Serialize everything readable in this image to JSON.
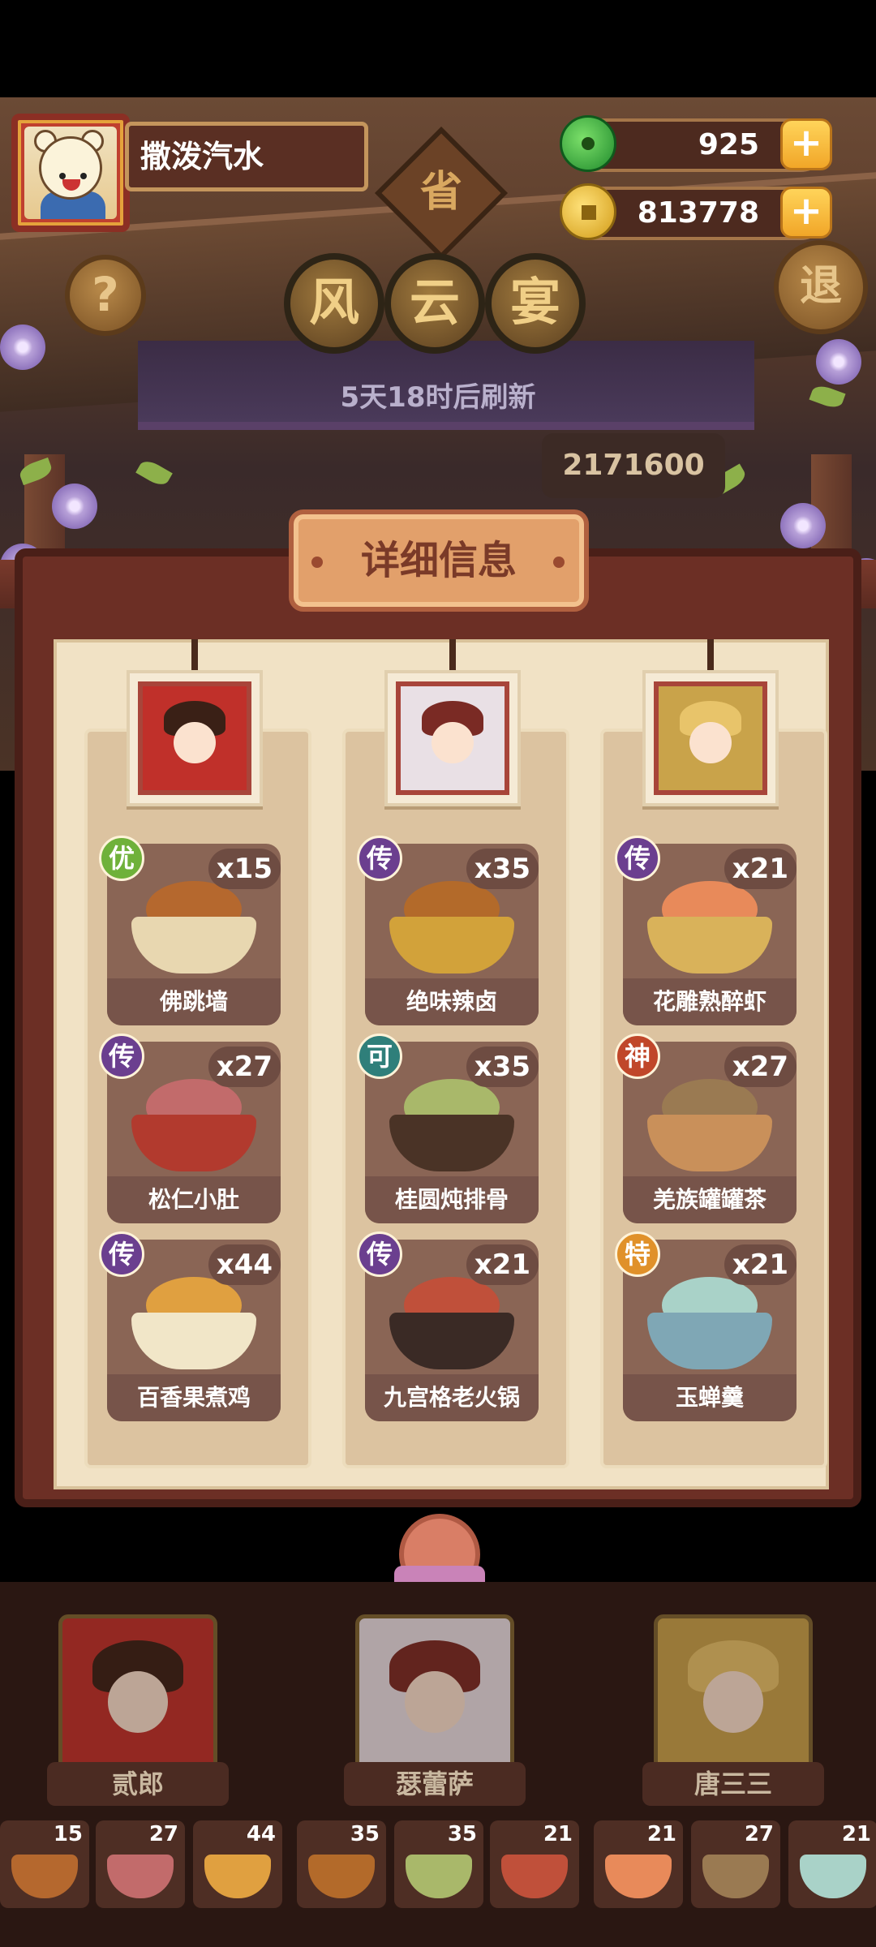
{
  "player": {
    "name": "撒泼汽水"
  },
  "resources": {
    "jade": "925",
    "coins": "813778"
  },
  "buttons": {
    "help": "?",
    "exit": "退",
    "plus": "+"
  },
  "province_badge": "省",
  "event_title": [
    "风",
    "云",
    "宴"
  ],
  "refresh_text": "5天18时后刷新",
  "score_peek": "2171600",
  "panel": {
    "header": "详细信息",
    "columns": [
      {
        "dishes": [
          {
            "grade": "优",
            "grade_color": "#6fb13a",
            "count": "x15",
            "name": "佛跳墙",
            "food_color": "#b5682e",
            "bowl_color": "#e8d7b0"
          },
          {
            "grade": "传",
            "grade_color": "#6b3f8f",
            "count": "x27",
            "name": "松仁小肚",
            "food_color": "#c26b6b",
            "bowl_color": "#b23a2e"
          },
          {
            "grade": "传",
            "grade_color": "#6b3f8f",
            "count": "x44",
            "name": "百香果煮鸡",
            "food_color": "#e0a040",
            "bowl_color": "#f1e6c8"
          }
        ]
      },
      {
        "dishes": [
          {
            "grade": "传",
            "grade_color": "#6b3f8f",
            "count": "x35",
            "name": "绝味辣卤",
            "food_color": "#b36a2a",
            "bowl_color": "#d2a23a"
          },
          {
            "grade": "可",
            "grade_color": "#2f7f7a",
            "count": "x35",
            "name": "桂圆炖排骨",
            "food_color": "#a9b86a",
            "bowl_color": "#4a3326"
          },
          {
            "grade": "传",
            "grade_color": "#6b3f8f",
            "count": "x21",
            "name": "九宫格老火锅",
            "food_color": "#c0503a",
            "bowl_color": "#3a2a25"
          }
        ]
      },
      {
        "dishes": [
          {
            "grade": "传",
            "grade_color": "#6b3f8f",
            "count": "x21",
            "name": "花雕熟醉虾",
            "food_color": "#e88a5a",
            "bowl_color": "#d9b25a"
          },
          {
            "grade": "神",
            "grade_color": "#c0472a",
            "count": "x27",
            "name": "羌族罐罐茶",
            "food_color": "#9a7a52",
            "bowl_color": "#c9905a"
          },
          {
            "grade": "特",
            "grade_color": "#e0912a",
            "count": "x21",
            "name": "玉蝉羹",
            "food_color": "#a9d2c8",
            "bowl_color": "#7fa7b5"
          }
        ]
      }
    ]
  },
  "chefs": [
    {
      "name": "贰郎",
      "hair_color": "#3a2016",
      "accent": "#c0302a"
    },
    {
      "name": "瑟蕾萨",
      "hair_color": "#7a2a24",
      "accent": "#e9e0e5"
    },
    {
      "name": "唐三三",
      "hair_color": "#e8c46a",
      "accent": "#c9a34a"
    }
  ],
  "inventory": [
    {
      "count": "15",
      "color": "#b5682e"
    },
    {
      "count": "27",
      "color": "#c26b6b"
    },
    {
      "count": "44",
      "color": "#e0a040"
    },
    {
      "count": "35",
      "color": "#b36a2a"
    },
    {
      "count": "35",
      "color": "#a9b86a"
    },
    {
      "count": "21",
      "color": "#c0503a"
    },
    {
      "count": "21",
      "color": "#e88a5a"
    },
    {
      "count": "27",
      "color": "#9a7a52"
    },
    {
      "count": "21",
      "color": "#a9d2c8"
    }
  ]
}
